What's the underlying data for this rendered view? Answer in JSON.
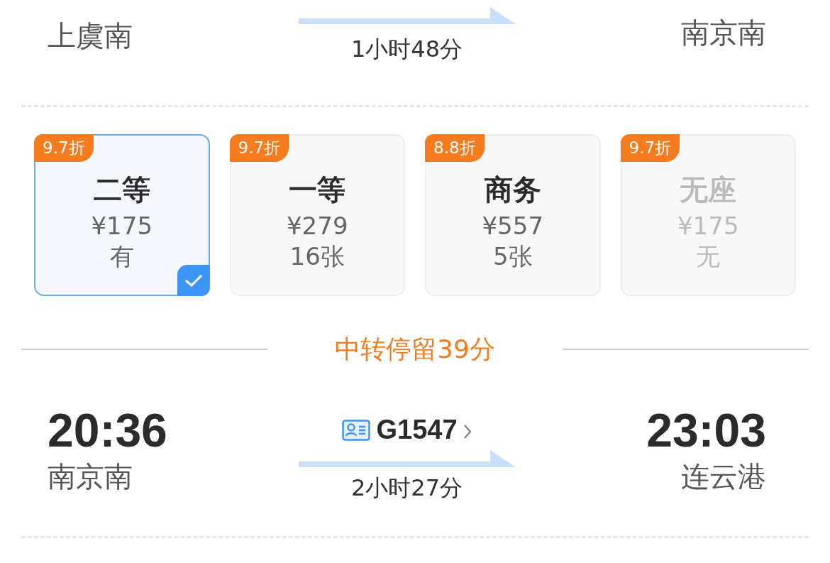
{
  "first_leg": {
    "depart_station": "上虞南",
    "arrive_station": "南京南",
    "duration": "1小时48分"
  },
  "seats": [
    {
      "discount": "9.7折",
      "class": "二等",
      "price": "¥175",
      "availability": "有",
      "selected": true,
      "disabled": false
    },
    {
      "discount": "9.7折",
      "class": "一等",
      "price": "¥279",
      "availability": "16张",
      "selected": false,
      "disabled": false
    },
    {
      "discount": "8.8折",
      "class": "商务",
      "price": "¥557",
      "availability": "5张",
      "selected": false,
      "disabled": false
    },
    {
      "discount": "9.7折",
      "class": "无座",
      "price": "¥175",
      "availability": "无",
      "selected": false,
      "disabled": true
    }
  ],
  "transfer": "中转停留39分",
  "second_leg": {
    "depart_time": "20:36",
    "depart_station": "南京南",
    "train_no": "G1547",
    "arrive_time": "23:03",
    "arrive_station": "连云港",
    "duration": "2小时27分"
  }
}
